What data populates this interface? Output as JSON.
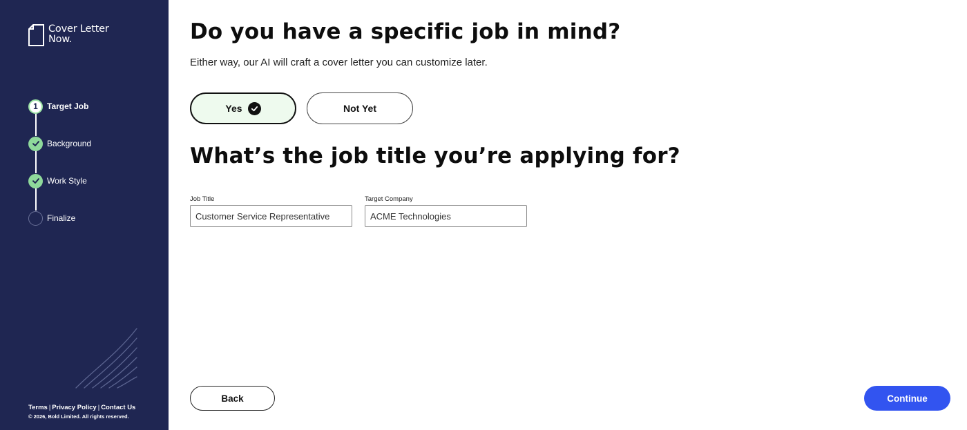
{
  "brand": {
    "line1": "Cover Letter",
    "line2": "Now."
  },
  "steps": [
    {
      "marker": "1",
      "label": "Target Job",
      "state": "current"
    },
    {
      "marker": "",
      "label": "Background",
      "state": "done"
    },
    {
      "marker": "",
      "label": "Work Style",
      "state": "done"
    },
    {
      "marker": "",
      "label": "Finalize",
      "state": "todo"
    }
  ],
  "footer": {
    "terms": "Terms",
    "privacy": "Privacy Policy",
    "contact": "Contact Us",
    "separator": "|",
    "copyright": "© 2026, Bold Limited. All rights reserved."
  },
  "question1": {
    "title": "Do you have a specific job in mind?",
    "subtitle": "Either way, our AI will craft a cover letter you can customize later.",
    "yes_label": "Yes",
    "no_label": "Not Yet",
    "selected": "Yes"
  },
  "question2": {
    "title": "What’s the job title you’re applying for?",
    "job_title_label": "Job Title",
    "job_title_value": "Customer Service Representative",
    "company_label": "Target Company",
    "company_value": "ACME Technologies"
  },
  "nav": {
    "back_label": "Back",
    "continue_label": "Continue"
  },
  "colors": {
    "sidebar_bg": "#1f2652",
    "step_done": "#8fd99b",
    "selected_bg": "#eefaee",
    "primary": "#3254f0"
  },
  "icons": {
    "logo": "document-icon",
    "selected_check": "check-circle-icon",
    "step_done": "check-icon",
    "decoration": "diagonal-lines-icon"
  }
}
